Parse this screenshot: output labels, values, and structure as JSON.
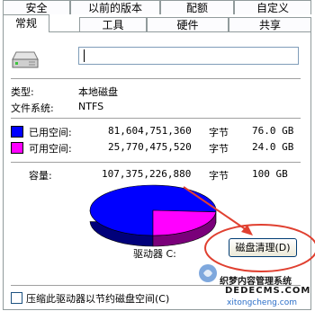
{
  "tabs_row1": [
    {
      "label": "安全",
      "active": false
    },
    {
      "label": "以前的版本",
      "active": false
    },
    {
      "label": "配额",
      "active": false
    },
    {
      "label": "自定义",
      "active": false
    }
  ],
  "tabs_row2": [
    {
      "label": "常规",
      "active": true
    },
    {
      "label": "工具",
      "active": false
    },
    {
      "label": "硬件",
      "active": false
    },
    {
      "label": "共享",
      "active": false
    }
  ],
  "general": {
    "name_value": "",
    "type_label": "类型:",
    "type_value": "本地磁盘",
    "fs_label": "文件系统:",
    "fs_value": "NTFS",
    "used_label": "已用空间:",
    "used_bytes": "81,604,751,360",
    "used_unit": "字节",
    "used_gb": "76.0 GB",
    "free_label": "可用空间:",
    "free_bytes": "25,770,475,520",
    "free_unit": "字节",
    "free_gb": "24.0 GB",
    "capacity_label": "容量:",
    "capacity_bytes": "107,375,226,880",
    "capacity_unit": "字节",
    "capacity_gb": "100 GB",
    "drive_label": "驱动器 C:",
    "cleanup_button": "磁盘清理(D)",
    "compress_label": "压缩此驱动器以节约磁盘空间(C)"
  },
  "chart_data": {
    "type": "pie",
    "categories": [
      "已用空间",
      "可用空间"
    ],
    "values": [
      81604751360,
      25770475520
    ]
  },
  "colors": {
    "used": "#0000ff",
    "free": "#ff00ff",
    "annotation": "#e04030"
  },
  "watermark": {
    "line1": "织梦内容管理系统",
    "line2": "DEDECMS.COM",
    "line3": "xitongcheng.com"
  }
}
